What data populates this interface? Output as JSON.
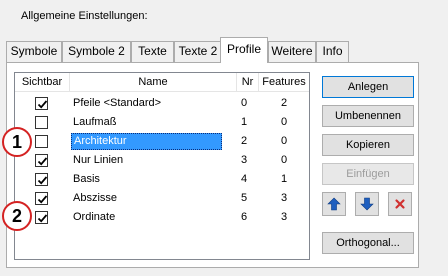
{
  "section_title": "Allgemeine Einstellungen:",
  "tabs": [
    {
      "label": "Symbole",
      "active": false
    },
    {
      "label": "Symbole 2",
      "active": false
    },
    {
      "label": "Texte",
      "active": false
    },
    {
      "label": "Texte 2",
      "active": false
    },
    {
      "label": "Profile",
      "active": true
    },
    {
      "label": "Weitere",
      "active": false
    },
    {
      "label": "Info",
      "active": false
    }
  ],
  "colors": {
    "badge_border": "#d42222",
    "selection": "#3399ff",
    "arrow_blue": "#1f5fbf",
    "delete_red": "#d0302f"
  },
  "listview": {
    "columns": [
      "Sichtbar",
      "Name",
      "Nr",
      "Features"
    ],
    "rows": [
      {
        "visible": true,
        "name": "Pfeile <Standard>",
        "nr": "0",
        "features": "2",
        "selected": false
      },
      {
        "visible": false,
        "name": "Laufmaß",
        "nr": "1",
        "features": "0",
        "selected": false
      },
      {
        "visible": false,
        "name": "Architektur",
        "nr": "2",
        "features": "0",
        "selected": true
      },
      {
        "visible": true,
        "name": "Nur Linien",
        "nr": "3",
        "features": "0",
        "selected": false
      },
      {
        "visible": true,
        "name": "Basis",
        "nr": "4",
        "features": "1",
        "selected": false
      },
      {
        "visible": true,
        "name": "Abszisse",
        "nr": "5",
        "features": "3",
        "selected": false
      },
      {
        "visible": true,
        "name": "Ordinate",
        "nr": "6",
        "features": "3",
        "selected": false
      }
    ]
  },
  "buttons": {
    "anlegen": "Anlegen",
    "umbenennen": "Umbenennen",
    "kopieren": "Kopieren",
    "einfuegen": "Einfügen",
    "orthogonal": "Orthogonal..."
  },
  "icons": {
    "move_up": "arrow-up-icon",
    "move_down": "arrow-down-icon",
    "delete": "delete-x-icon"
  },
  "annotations": {
    "badge1": "1",
    "badge2": "2"
  }
}
